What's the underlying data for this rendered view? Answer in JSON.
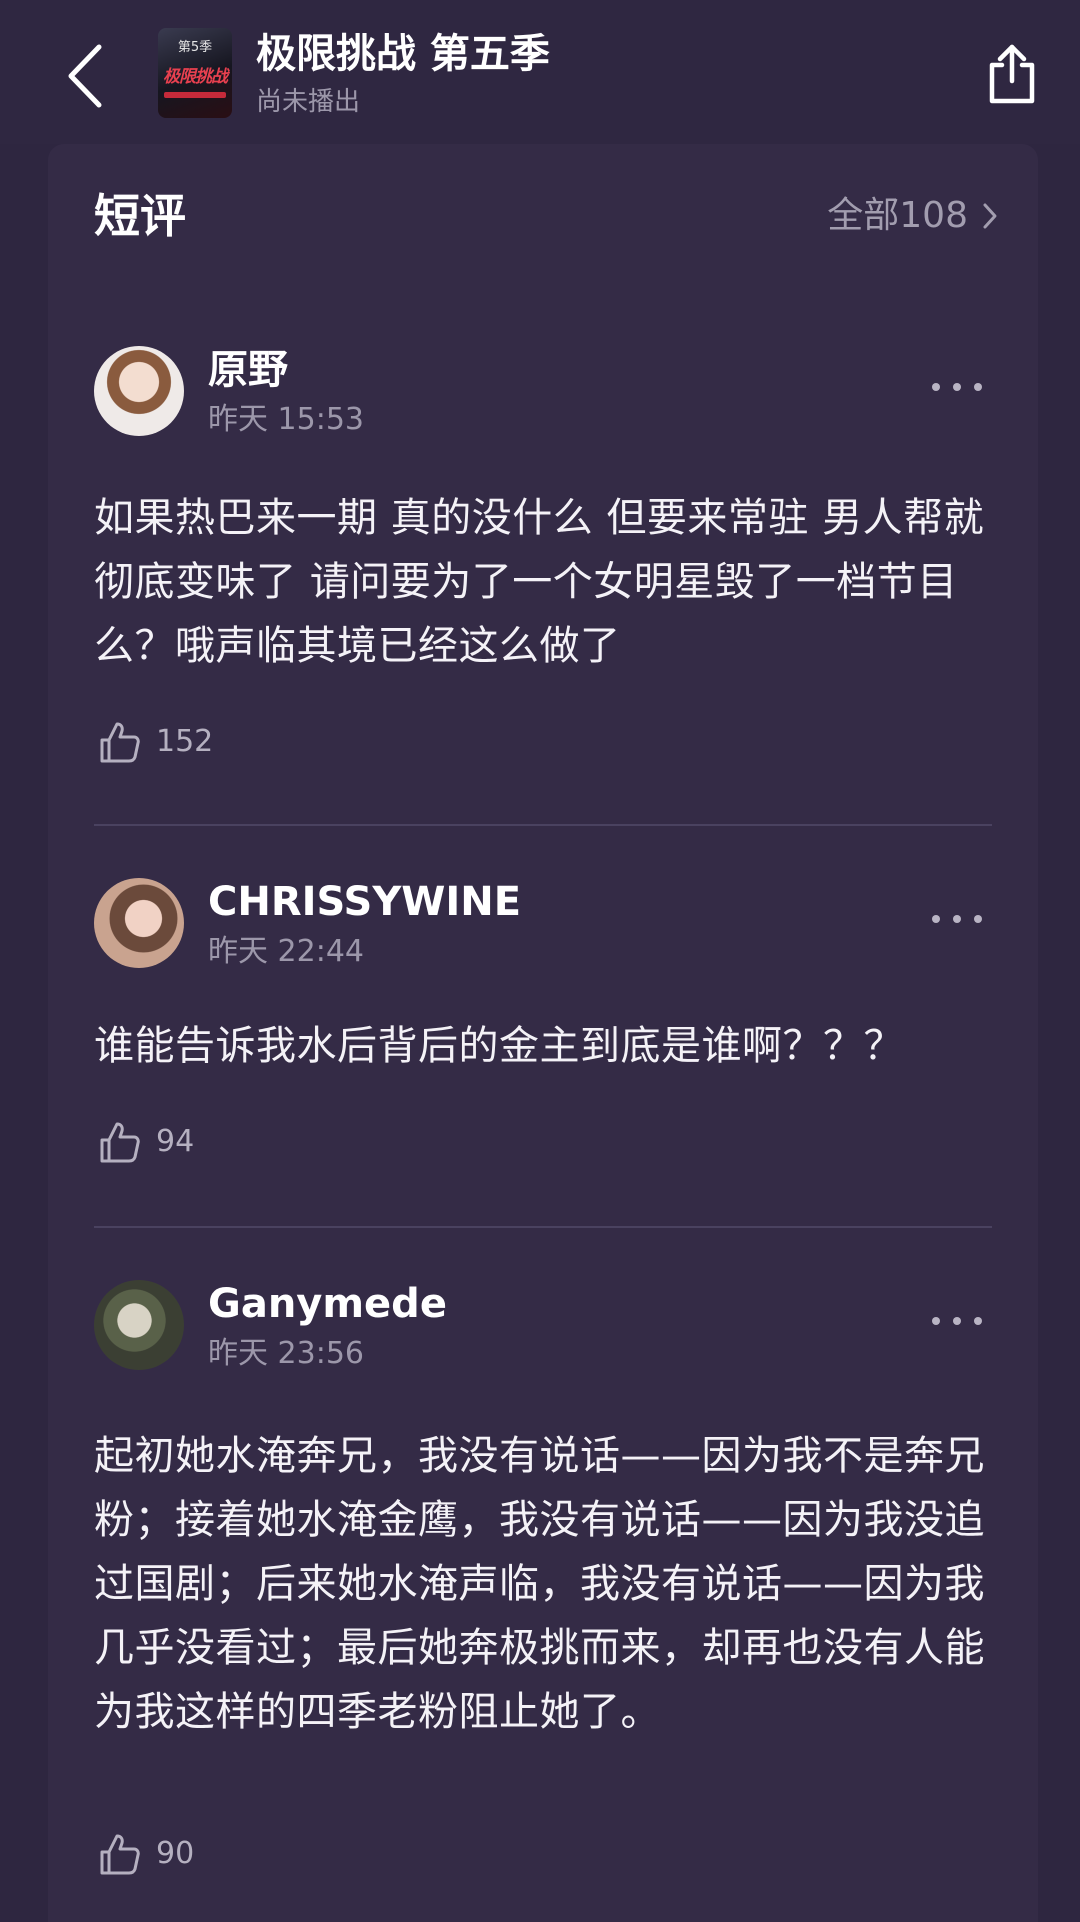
{
  "header": {
    "title": "极限挑战 第五季",
    "status": "尚未播出",
    "poster": {
      "season_text": "第5季",
      "logo_text": "极限挑战"
    },
    "back_icon": "chevron-left-icon",
    "share_icon": "share-icon"
  },
  "section": {
    "title": "短评",
    "all_label": "全部108"
  },
  "reviews": [
    {
      "user": "原野",
      "time": "昨天 15:53",
      "text": "如果热巴来一期 真的没什么 但要来常驻 男人帮就彻底变味了 请问要为了一个女明星毁了一档节目么？哦声临其境已经这么做了",
      "likes": "152"
    },
    {
      "user": "CHRISSYWINE",
      "time": "昨天 22:44",
      "text": "谁能告诉我水后背后的金主到底是谁啊？？？",
      "likes": "94"
    },
    {
      "user": "Ganymede",
      "time": "昨天 23:56",
      "text": "起初她水淹奔兄，我没有说话——因为我不是奔兄粉；接着她水淹金鹰，我没有说话——因为我没追过国剧；后来她水淹声临，我没有说话——因为我几乎没看过；最后她奔极挑而来，却再也没有人能为我这样的四季老粉阻止她了。",
      "likes": "90"
    }
  ],
  "colors": {
    "background": "#2e2640",
    "card": "#342b46",
    "muted_text": "#9c97aa"
  }
}
